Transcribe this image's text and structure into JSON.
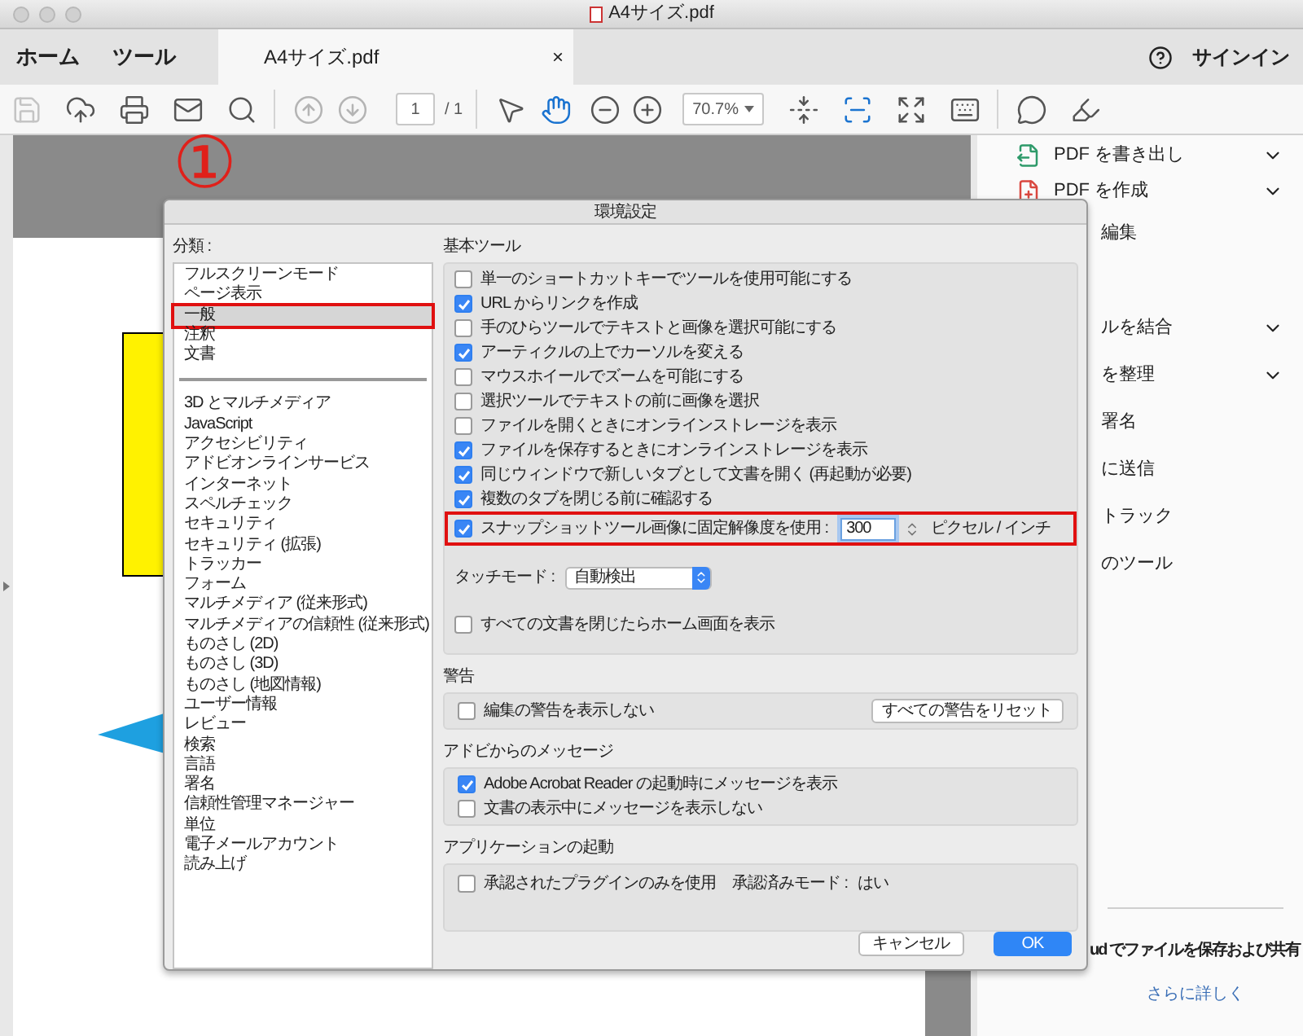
{
  "window": {
    "title": "A4サイズ.pdf"
  },
  "nav_tabs": [
    {
      "label": "ホーム",
      "selected": false
    },
    {
      "label": "ツール",
      "selected": false
    }
  ],
  "document_tab": {
    "label": "A4サイズ.pdf",
    "close": "×",
    "selected": true
  },
  "sign_in": "サインイン",
  "toolbar": {
    "file_buttons": [
      {
        "kind": "save",
        "disabled": true
      },
      {
        "kind": "upload",
        "disabled": false
      },
      {
        "kind": "print",
        "disabled": false
      },
      {
        "kind": "mail",
        "disabled": false
      },
      {
        "kind": "search",
        "disabled": false
      }
    ],
    "page_buttons": [
      {
        "kind": "prev",
        "disabled": true
      },
      {
        "kind": "next",
        "disabled": true
      }
    ],
    "page": {
      "current": "1",
      "total": "/ 1"
    },
    "tools": [
      {
        "kind": "select",
        "selected": false
      },
      {
        "kind": "hand",
        "selected": true
      }
    ],
    "zoom_buttons": [
      {
        "kind": "zoom_out"
      },
      {
        "kind": "zoom_in"
      }
    ],
    "zoom": "70.7%",
    "view_buttons": [
      {
        "kind": "fit",
        "on": false
      },
      {
        "kind": "scroll",
        "on": true
      },
      {
        "kind": "fullscreen",
        "on": false
      },
      {
        "kind": "read",
        "on": false
      }
    ],
    "comment_buttons": [
      {
        "kind": "comment"
      },
      {
        "kind": "highlight"
      }
    ]
  },
  "annotation": "①",
  "right_panel": {
    "items": [
      {
        "kind": "export",
        "label": "PDF を書き出し",
        "expandable": true
      },
      {
        "kind": "create",
        "label": "PDF を作成",
        "expandable": true
      },
      {
        "kind": "covered",
        "label": "編集",
        "expandable": false
      },
      {
        "kind": "covered",
        "label": "ルを結合",
        "expandable": true
      },
      {
        "kind": "covered",
        "label": "を整理",
        "expandable": true
      },
      {
        "kind": "covered",
        "label": "署名",
        "expandable": false
      },
      {
        "kind": "covered",
        "label": "に送信",
        "expandable": false
      },
      {
        "kind": "covered",
        "label": "トラック",
        "expandable": false
      },
      {
        "kind": "covered",
        "label": "のツール",
        "expandable": false
      }
    ],
    "promo": "ud でファイルを保存および共有",
    "link": "さらに詳しく"
  },
  "dialog": {
    "title": "環境設定",
    "category_label": "分類 :",
    "category_groups": [
      [
        {
          "label": "フルスクリーンモード",
          "selected": false
        },
        {
          "label": "ページ表示",
          "selected": false
        },
        {
          "label": "一般",
          "selected": true
        },
        {
          "label": "注釈",
          "selected": false
        },
        {
          "label": "文書",
          "selected": false
        }
      ],
      [
        {
          "label": "3D とマルチメディア",
          "selected": false
        },
        {
          "label": "JavaScript",
          "selected": false
        },
        {
          "label": "アクセシビリティ",
          "selected": false
        },
        {
          "label": "アドビオンラインサービス",
          "selected": false
        },
        {
          "label": "インターネット",
          "selected": false
        },
        {
          "label": "スペルチェック",
          "selected": false
        },
        {
          "label": "セキュリティ",
          "selected": false
        },
        {
          "label": "セキュリティ (拡張)",
          "selected": false
        },
        {
          "label": "トラッカー",
          "selected": false
        },
        {
          "label": "フォーム",
          "selected": false
        },
        {
          "label": "マルチメディア (従来形式)",
          "selected": false
        },
        {
          "label": "マルチメディアの信頼性 (従来形式)",
          "selected": false
        },
        {
          "label": "ものさし (2D)",
          "selected": false
        },
        {
          "label": "ものさし (3D)",
          "selected": false
        },
        {
          "label": "ものさし (地図情報)",
          "selected": false
        },
        {
          "label": "ユーザー情報",
          "selected": false
        },
        {
          "label": "レビュー",
          "selected": false
        },
        {
          "label": "検索",
          "selected": false
        },
        {
          "label": "言語",
          "selected": false
        },
        {
          "label": "署名",
          "selected": false
        },
        {
          "label": "信頼性管理マネージャー",
          "selected": false
        },
        {
          "label": "単位",
          "selected": false
        },
        {
          "label": "電子メールアカウント",
          "selected": false
        },
        {
          "label": "読み上げ",
          "selected": false
        }
      ]
    ],
    "basic_tools": {
      "title": "基本ツール",
      "options": [
        {
          "kind": "checkbox",
          "label": "単一のショートカットキーでツールを使用可能にする",
          "checked": false,
          "marked": false
        },
        {
          "kind": "checkbox",
          "label": "URL からリンクを作成",
          "checked": true,
          "marked": false
        },
        {
          "kind": "checkbox",
          "label": "手のひらツールでテキストと画像を選択可能にする",
          "checked": false,
          "marked": false
        },
        {
          "kind": "checkbox",
          "label": "アーティクルの上でカーソルを変える",
          "checked": true,
          "marked": false
        },
        {
          "kind": "checkbox",
          "label": "マウスホイールでズームを可能にする",
          "checked": false,
          "marked": false
        },
        {
          "kind": "checkbox",
          "label": "選択ツールでテキストの前に画像を選択",
          "checked": false,
          "marked": false
        },
        {
          "kind": "checkbox",
          "label": "ファイルを開くときにオンラインストレージを表示",
          "checked": false,
          "marked": false
        },
        {
          "kind": "checkbox",
          "label": "ファイルを保存するときにオンラインストレージを表示",
          "checked": true,
          "marked": false
        },
        {
          "kind": "checkbox",
          "label": "同じウィンドウで新しいタブとして文書を開く (再起動が必要)",
          "checked": true,
          "marked": false
        },
        {
          "kind": "checkbox",
          "label": "複数のタブを閉じる前に確認する",
          "checked": true,
          "marked": false
        },
        {
          "kind": "resolution",
          "label": "スナップショットツール画像に固定解像度を使用 :",
          "checked": true,
          "marked": true,
          "value": "300",
          "unit": "ピクセル / インチ"
        }
      ],
      "touch_mode": {
        "label": "タッチモード :",
        "value": "自動検出"
      },
      "home_option": {
        "label": "すべての文書を閉じたらホーム画面を表示",
        "checked": false
      }
    },
    "warnings": {
      "title": "警告",
      "option": {
        "label": "編集の警告を表示しない",
        "checked": false
      },
      "reset_button": "すべての警告をリセット"
    },
    "messages": {
      "title": "アドビからのメッセージ",
      "options": [
        {
          "label": "Adobe Acrobat Reader の起動時にメッセージを表示",
          "checked": true
        },
        {
          "label": "文書の表示中にメッセージを表示しない",
          "checked": false
        }
      ]
    },
    "startup": {
      "title": "アプリケーションの起動",
      "option": {
        "label": "承認されたプラグインのみを使用",
        "checked": false
      },
      "mode_label": "承認済みモード :",
      "mode_value": "はい"
    },
    "buttons": {
      "cancel": "キャンセル",
      "ok": "OK"
    }
  }
}
